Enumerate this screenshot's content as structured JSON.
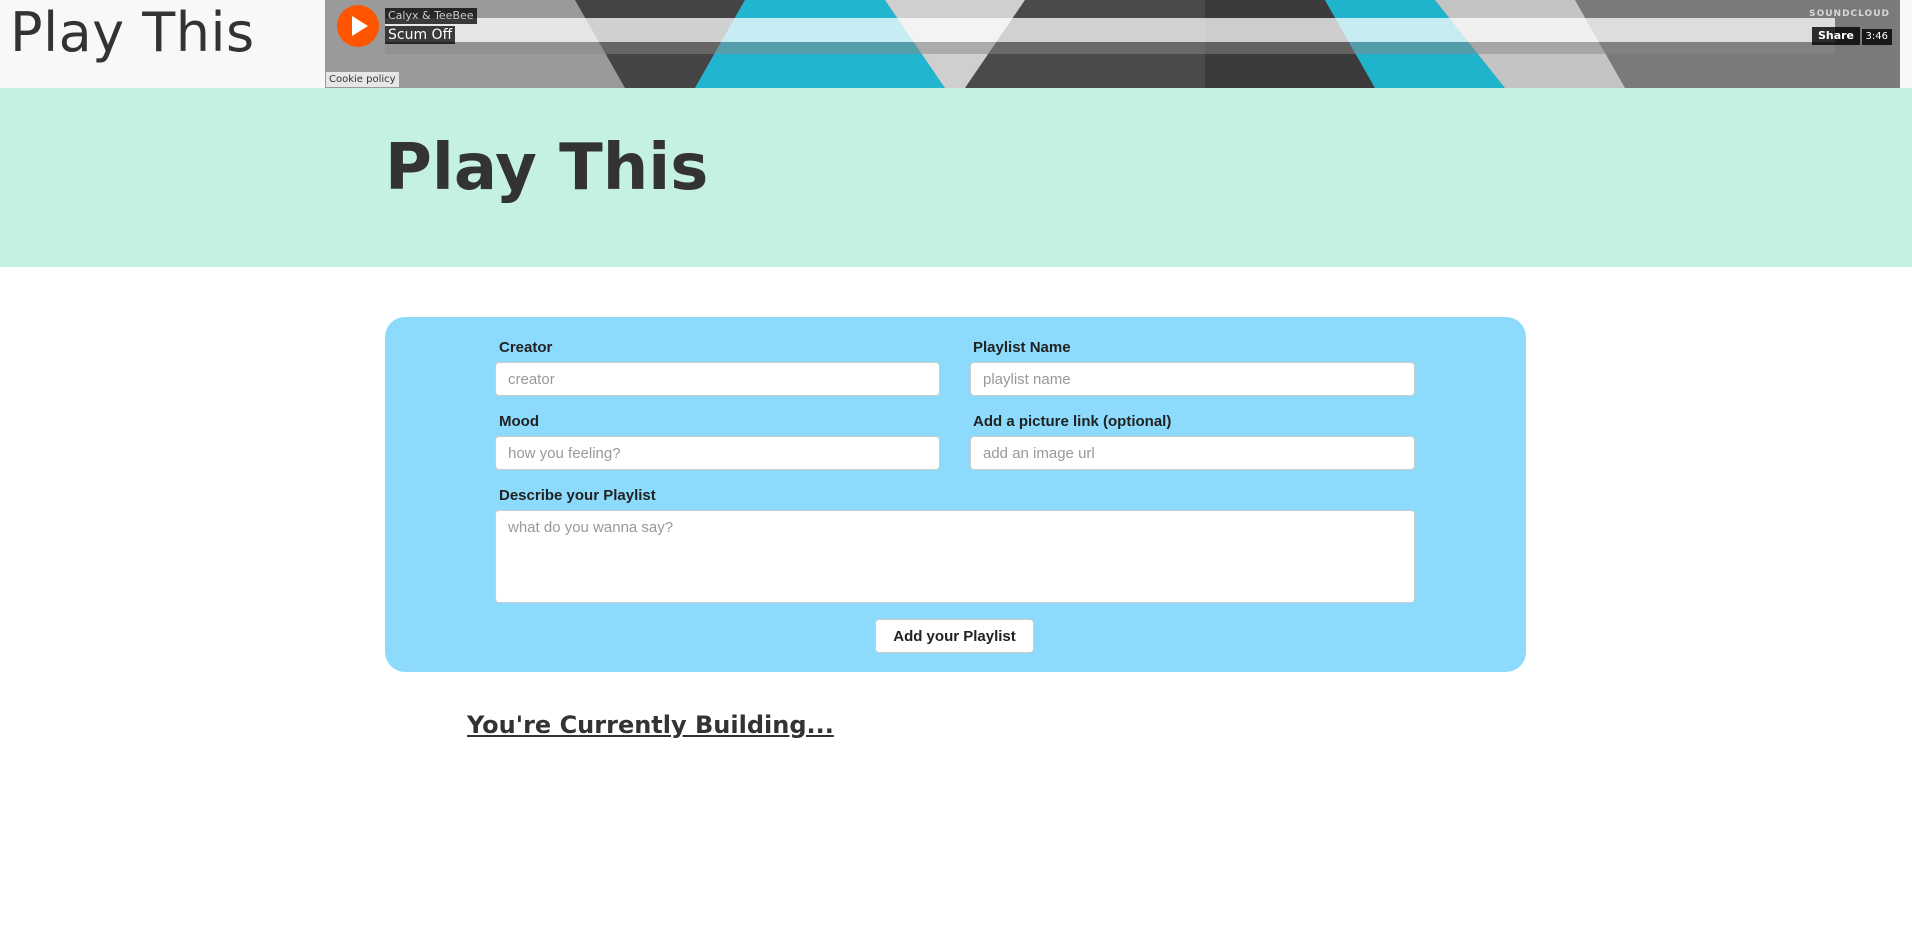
{
  "header": {
    "brand": "Play This"
  },
  "player": {
    "artist": "Calyx & TeeBee",
    "track": "Scum Off",
    "duration": "3:46",
    "share_label": "Share",
    "brand": "SOUNDCLOUD",
    "cookie_label": "Cookie policy",
    "accent": "#ff5500"
  },
  "hero": {
    "title": "Play This"
  },
  "form": {
    "creator": {
      "label": "Creator",
      "placeholder": "creator"
    },
    "playlist_name": {
      "label": "Playlist Name",
      "placeholder": "playlist name"
    },
    "mood": {
      "label": "Mood",
      "placeholder": "how you feeling?"
    },
    "picture": {
      "label": "Add a picture link (optional)",
      "placeholder": "add an image url"
    },
    "description": {
      "label": "Describe your Playlist",
      "placeholder": "what do you wanna say?"
    },
    "submit_label": "Add your Playlist"
  },
  "section": {
    "building_title": "You're Currently Building..."
  },
  "colors": {
    "hero_bg": "#c5f1e2",
    "card_bg": "#8cdbfc",
    "topbar_bg": "#f8f8f8"
  }
}
